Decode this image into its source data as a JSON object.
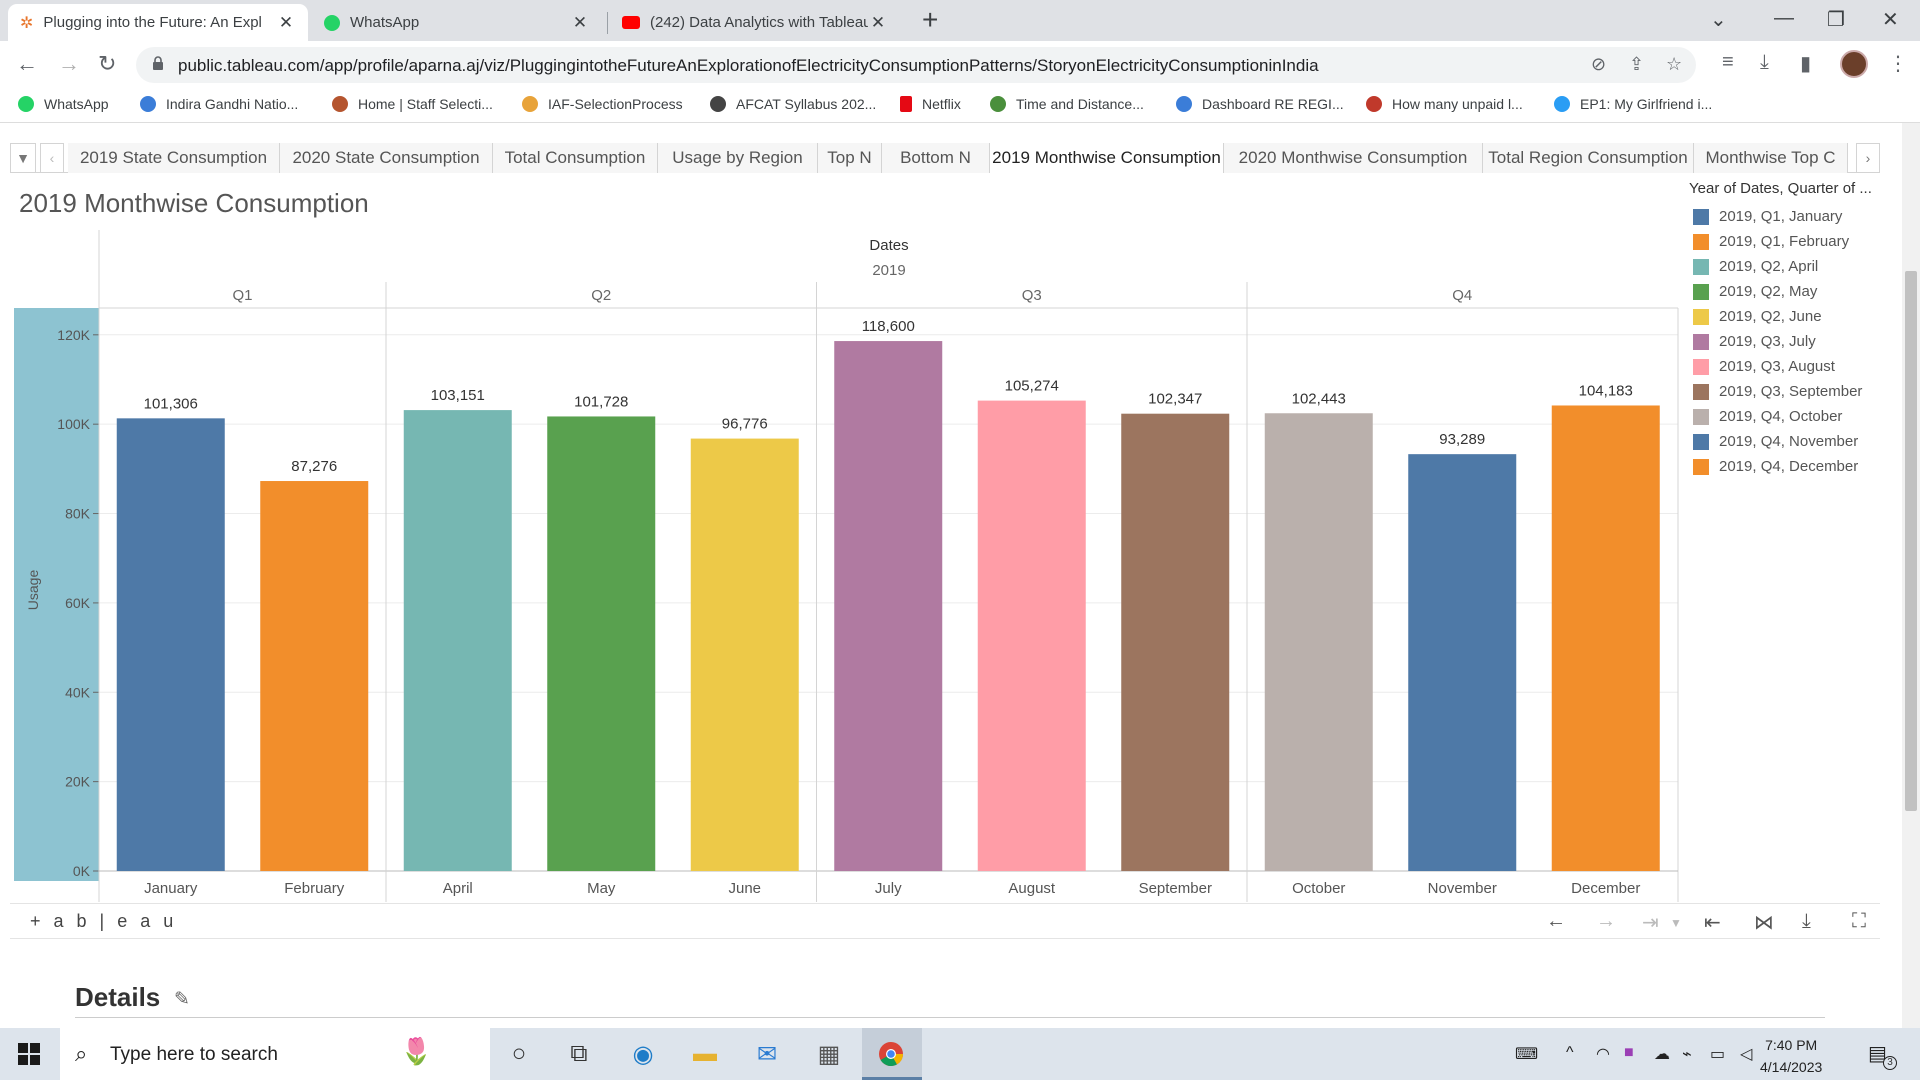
{
  "browser": {
    "tabs": [
      {
        "title": "Plugging into the Future: An Expl",
        "active": true,
        "icon": "tableau-icon"
      },
      {
        "title": "WhatsApp",
        "active": false,
        "icon": "whatsapp-icon"
      },
      {
        "title": "(242) Data Analytics with Tableau",
        "active": false,
        "icon": "youtube-icon"
      }
    ],
    "url": "public.tableau.com/app/profile/aparna.aj/viz/PluggingintotheFutureAnExplorationofElectricityConsumptionPatterns/StoryonElectricityConsumptioninIndia",
    "bookmarks": [
      {
        "label": "WhatsApp",
        "color": "#25d366"
      },
      {
        "label": "Indira Gandhi Natio...",
        "color": "#3b7dd8"
      },
      {
        "label": "Home | Staff Selecti...",
        "color": "#b5552f"
      },
      {
        "label": "IAF-SelectionProcess",
        "color": "#e8a33a"
      },
      {
        "label": "AFCAT Syllabus 202...",
        "color": "#444444"
      },
      {
        "label": "Netflix",
        "color": "#e50914"
      },
      {
        "label": "Time and Distance...",
        "color": "#4a8f3c"
      },
      {
        "label": "Dashboard RE REGI...",
        "color": "#3b7dd8"
      },
      {
        "label": "How many unpaid l...",
        "color": "#c0392b"
      },
      {
        "label": "EP1: My Girlfriend i...",
        "color": "#2a9df4"
      }
    ]
  },
  "story": {
    "tabs": [
      "2019 State Consumption",
      "2020 State Consumption",
      "Total Consumption",
      "Usage by Region",
      "Top N",
      "Bottom N",
      "2019 Monthwise Consumption",
      "2020 Monthwise Consumption",
      "Total Region Consumption",
      "Monthwise Top C"
    ],
    "active_tab": "2019 Monthwise Consumption",
    "viz_title": "2019 Monthwise Consumption",
    "legend_title": "Year of Dates, Quarter of ..."
  },
  "chart_data": {
    "type": "bar",
    "header": "Dates",
    "year": "2019",
    "quarters": [
      "Q1",
      "Q2",
      "Q3",
      "Q4"
    ],
    "categories": [
      "January",
      "February",
      "April",
      "May",
      "June",
      "July",
      "August",
      "September",
      "October",
      "November",
      "December"
    ],
    "quarter_of_category": [
      "Q1",
      "Q1",
      "Q2",
      "Q2",
      "Q2",
      "Q3",
      "Q3",
      "Q3",
      "Q4",
      "Q4",
      "Q4"
    ],
    "values": [
      101306,
      87276,
      103151,
      101728,
      96776,
      118600,
      105274,
      102347,
      102443,
      93289,
      104183
    ],
    "value_labels": [
      "101,306",
      "87,276",
      "103,151",
      "101,728",
      "96,776",
      "118,600",
      "105,274",
      "102,347",
      "102,443",
      "93,289",
      "104,183"
    ],
    "colors": [
      "#4e79a7",
      "#f28e2b",
      "#76b7b2",
      "#59a14f",
      "#edc948",
      "#b07aa1",
      "#ff9da7",
      "#9c755f",
      "#bab0ac",
      "#4e79a7",
      "#f28e2b"
    ],
    "legend": [
      "2019, Q1, January",
      "2019, Q1, February",
      "2019, Q2, April",
      "2019, Q2, May",
      "2019, Q2, June",
      "2019, Q3, July",
      "2019, Q3, August",
      "2019, Q3, September",
      "2019, Q4, October",
      "2019, Q4, November",
      "2019, Q4, December"
    ],
    "ylabel": "Usage",
    "yticks": [
      0,
      20000,
      40000,
      60000,
      80000,
      100000,
      120000
    ],
    "ytick_labels": [
      "0K",
      "20K",
      "40K",
      "60K",
      "80K",
      "100K",
      "120K"
    ],
    "ylim": [
      0,
      126000
    ],
    "grid": true
  },
  "tableau_footer": {
    "logo": "+ a b | e a u"
  },
  "details": {
    "heading": "Details"
  },
  "taskbar": {
    "search_placeholder": "Type here to search",
    "time": "7:40 PM",
    "date": "4/14/2023",
    "notification_count": "3"
  }
}
